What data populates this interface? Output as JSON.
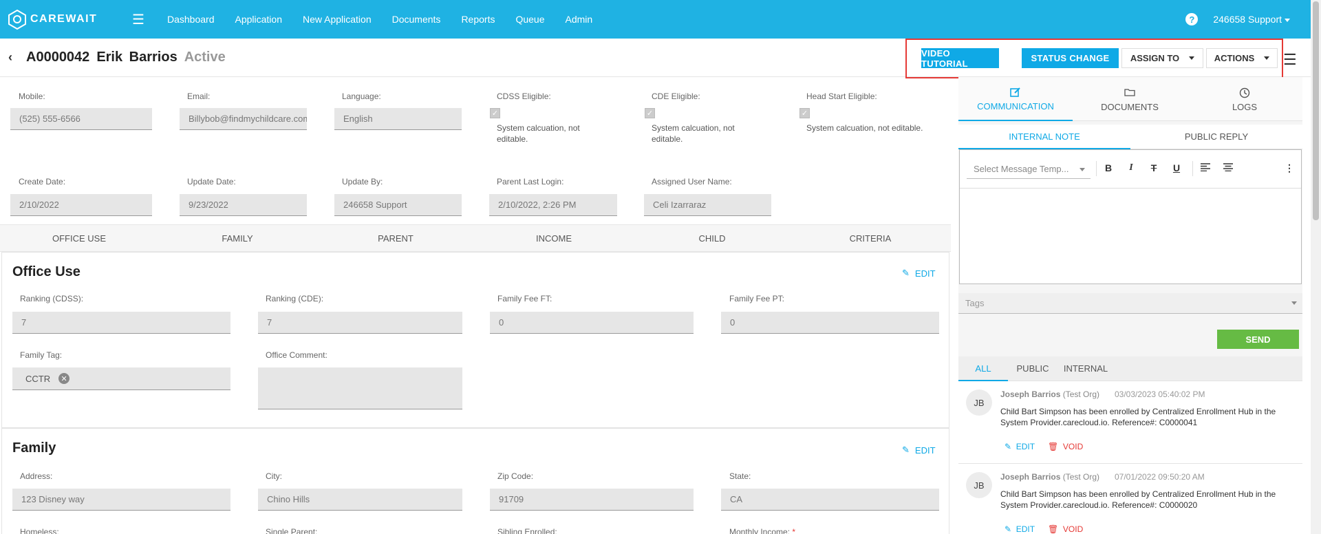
{
  "app": {
    "brand": "CAREWAIT"
  },
  "nav": {
    "links": [
      "Dashboard",
      "Application",
      "New Application",
      "Documents",
      "Reports",
      "Queue",
      "Admin"
    ],
    "help": "?",
    "user": "246658 Support"
  },
  "header": {
    "id": "A0000042",
    "name": "Erik  Barrios",
    "status": "Active",
    "video_tutorial": "VIDEO TUTORIAL",
    "status_change": "STATUS CHANGE",
    "assign_to": "ASSIGN TO",
    "actions": "ACTIONS"
  },
  "info": {
    "mobile_label": "Mobile:",
    "mobile": "(525) 555-6566",
    "email_label": "Email:",
    "email": "Billybob@findmychildcare.com",
    "language_label": "Language:",
    "language": "English",
    "cdss_label": "CDSS Eligible:",
    "cdss_note": "System calcuation, not editable.",
    "cde_label": "CDE Eligible:",
    "cde_note": "System calcuation, not editable.",
    "headstart_label": "Head Start Eligible:",
    "headstart_note": "System calcuation, not editable.",
    "create_label": "Create Date:",
    "create": "2/10/2022",
    "update_label": "Update Date:",
    "update": "9/23/2022",
    "updateby_label": "Update By:",
    "updateby": "246658 Support",
    "login_label": "Parent Last Login:",
    "login": "2/10/2022, 2:26 PM",
    "assigned_label": "Assigned User Name:",
    "assigned": "Celi Izarraraz"
  },
  "section_tabs": [
    "OFFICE USE",
    "FAMILY",
    "PARENT",
    "INCOME",
    "CHILD",
    "CRITERIA"
  ],
  "office_use": {
    "title": "Office Use",
    "edit": "EDIT",
    "rank_cdss_label": "Ranking (CDSS):",
    "rank_cdss": "7",
    "rank_cde_label": "Ranking (CDE):",
    "rank_cde": "7",
    "fee_ft_label": "Family Fee FT:",
    "fee_ft": "0",
    "fee_pt_label": "Family Fee PT:",
    "fee_pt": "0",
    "tag_label": "Family Tag:",
    "tag": "CCTR",
    "comment_label": "Office Comment:"
  },
  "family": {
    "title": "Family",
    "edit": "EDIT",
    "address_label": "Address:",
    "address": "123 Disney way",
    "city_label": "City:",
    "city": "Chino Hills",
    "zip_label": "Zip Code:",
    "zip": "91709",
    "state_label": "State:",
    "state": "CA",
    "homeless_label": "Homeless:",
    "single_parent_label": "Single Parent:",
    "sibling_label": "Sibling Enrolled:",
    "income_label": "Monthly Income:",
    "required_mark": "*"
  },
  "right_panel": {
    "tabs": [
      "COMMUNICATION",
      "DOCUMENTS",
      "LOGS"
    ],
    "sub_tabs": [
      "INTERNAL NOTE",
      "PUBLIC REPLY"
    ],
    "template_placeholder": "Select Message Temp...",
    "tags_placeholder": "Tags",
    "send": "SEND",
    "filters": [
      "ALL",
      "PUBLIC",
      "INTERNAL"
    ],
    "messages": [
      {
        "initials": "JB",
        "author": "Joseph Barrios",
        "org": "(Test Org)",
        "date": "03/03/2023 05:40:02 PM",
        "body": "Child Bart Simpson has been enrolled by Centralized Enrollment Hub in the System Provider.carecloud.io. Reference#: C0000041",
        "edit": "EDIT",
        "void": "VOID"
      },
      {
        "initials": "JB",
        "author": "Joseph Barrios",
        "org": "(Test Org)",
        "date": "07/01/2022 09:50:20 AM",
        "body": "Child Bart Simpson has been enrolled by Centralized Enrollment Hub in the System Provider.carecloud.io. Reference#: C0000020",
        "edit": "EDIT",
        "void": "VOID"
      }
    ]
  },
  "colors": {
    "brand": "#1fb2e3",
    "accent": "#0fa9e6",
    "send": "#66bb44",
    "highlight": "#e53935"
  }
}
